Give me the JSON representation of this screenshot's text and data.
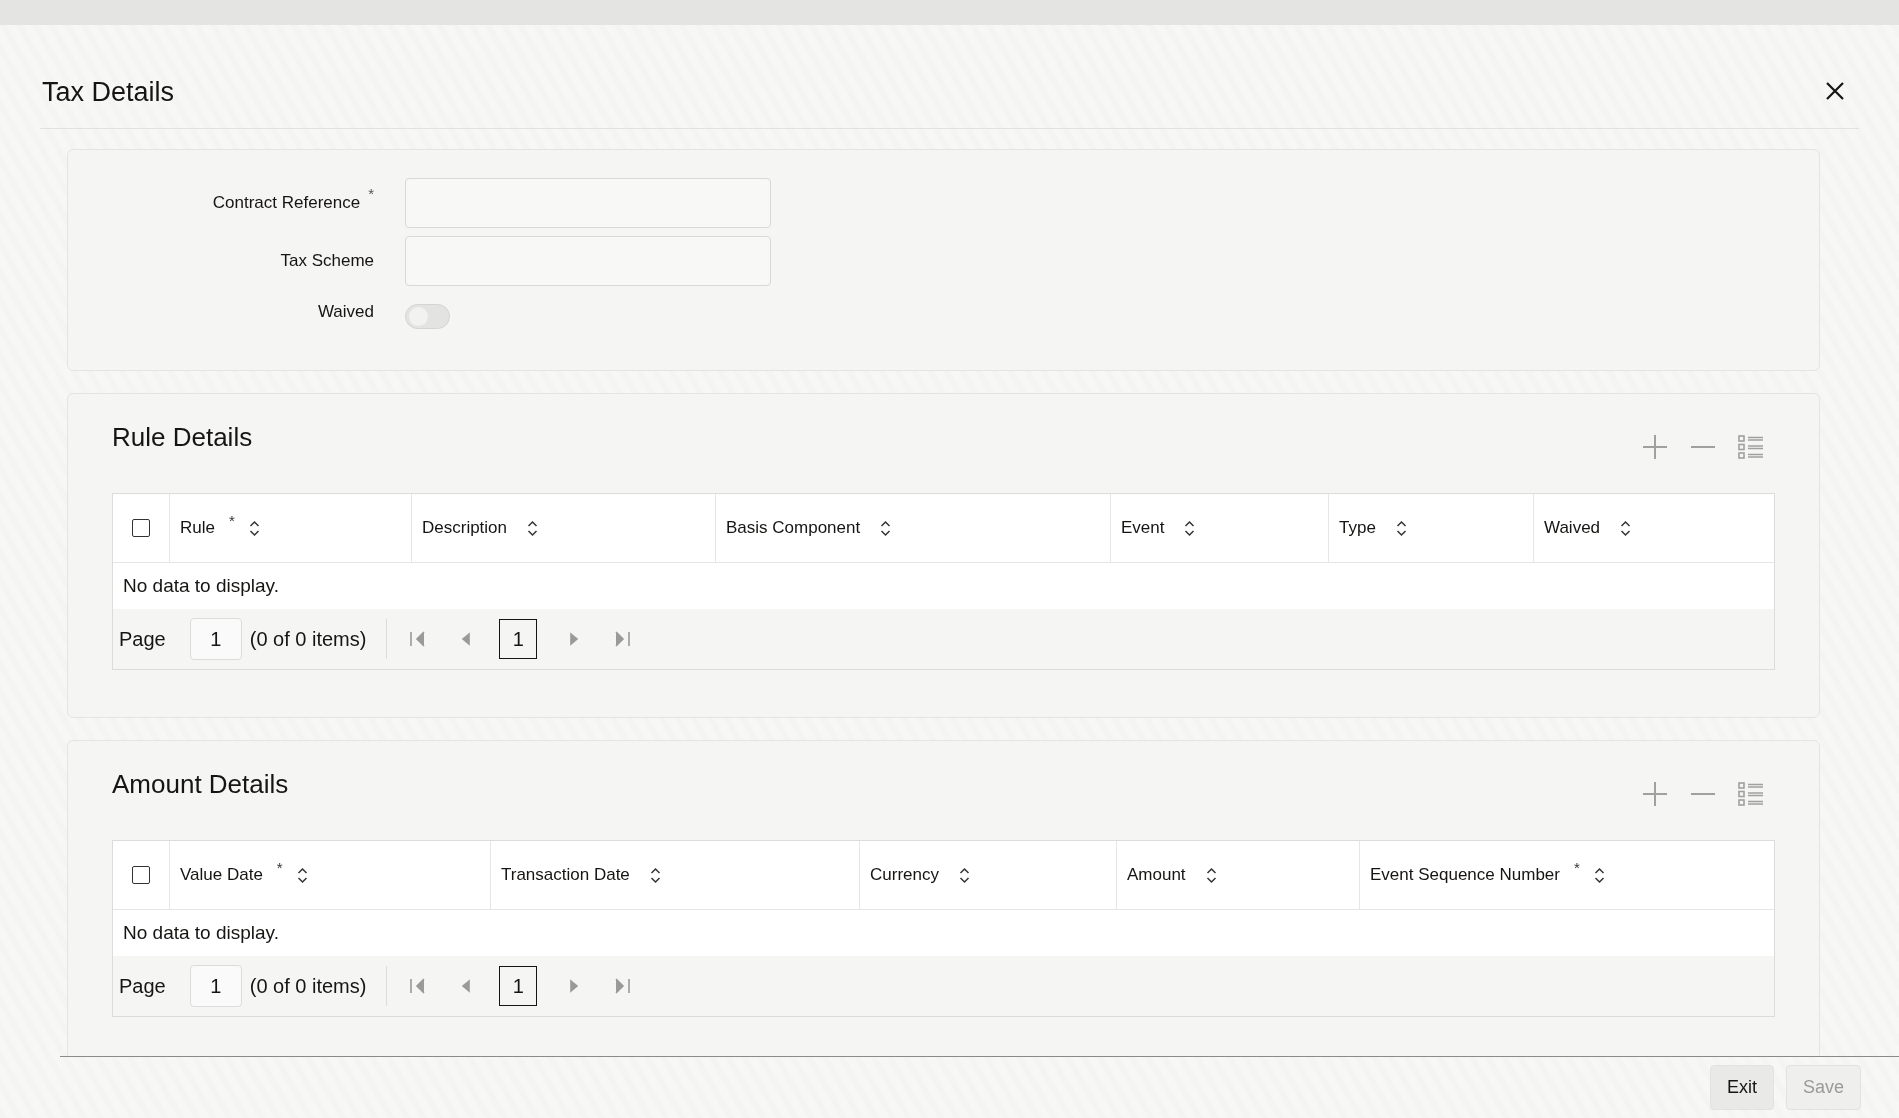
{
  "window": {
    "title": "Tax Details"
  },
  "form": {
    "fields": [
      {
        "kind": "text",
        "label": "Contract Reference",
        "mark": "*"
      },
      {
        "kind": "text",
        "label": "Tax Scheme"
      },
      {
        "kind": "toggle",
        "label": "Waived",
        "on": false
      }
    ]
  },
  "sections": [
    {
      "title": "Rule Details",
      "select_all_checked": false,
      "columns": [
        {
          "label": "Rule",
          "mark": "*"
        },
        {
          "label": "Description"
        },
        {
          "label": "Basis Component"
        },
        {
          "label": "Event"
        },
        {
          "label": "Type"
        },
        {
          "label": "Waived"
        }
      ],
      "empty_message": "No data to display.",
      "pager": {
        "label": "Page",
        "page": "1",
        "summary": "(0 of 0 items)",
        "current": "1"
      }
    },
    {
      "title": "Amount Details",
      "select_all_checked": false,
      "columns": [
        {
          "label": "Value Date",
          "mark": "*"
        },
        {
          "label": "Transaction Date"
        },
        {
          "label": "Currency"
        },
        {
          "label": "Amount"
        },
        {
          "label": "Event Sequence Number",
          "mark": "*"
        }
      ],
      "empty_message": "No data to display.",
      "pager": {
        "label": "Page",
        "page": "1",
        "summary": "(0 of 0 items)",
        "current": "1"
      }
    }
  ],
  "buttons": [
    {
      "label": "Exit",
      "disabled": false
    },
    {
      "label": "Save",
      "disabled": true
    }
  ]
}
